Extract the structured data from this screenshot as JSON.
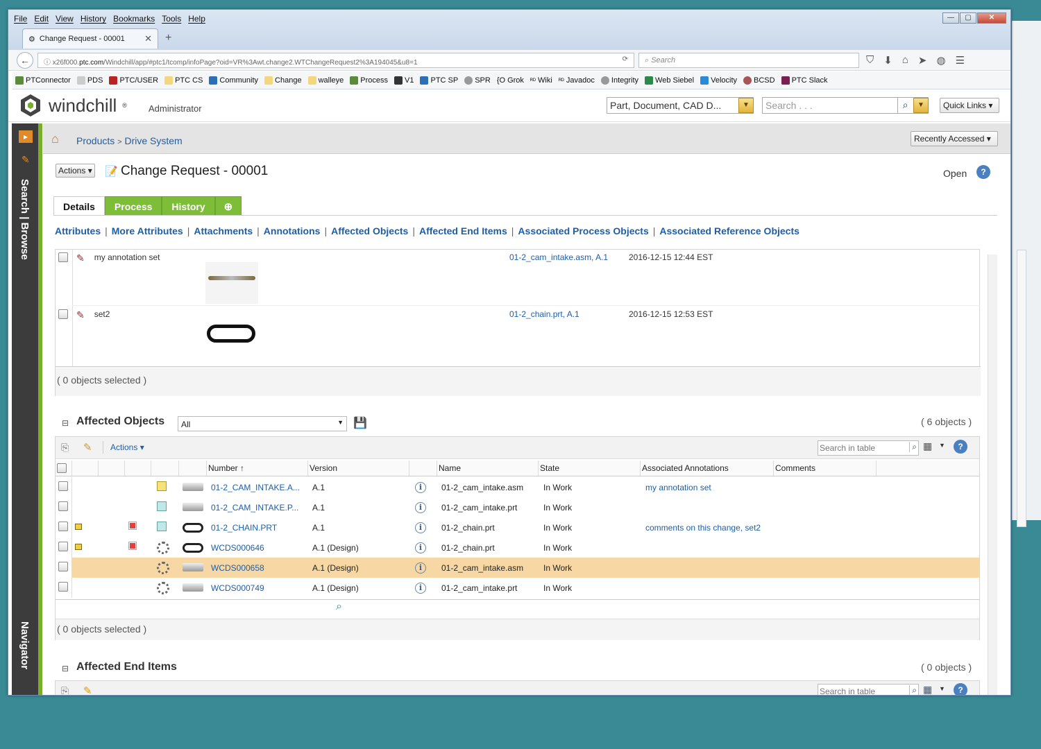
{
  "browser": {
    "menu": [
      "File",
      "Edit",
      "View",
      "History",
      "Bookmarks",
      "Tools",
      "Help"
    ],
    "tab_title": "Change Request - 00001",
    "url_prefix": "x26f000.",
    "url_host": "ptc.com",
    "url_rest": "/Windchill/app/#ptc1/tcomp/infoPage?oid=VR%3Awt.change2.WTChangeRequest2%3A194045&u8=1",
    "search_placeholder": "Search",
    "bookmarks": [
      "PTConnector",
      "PDS",
      "PTC/USER",
      "PTC CS",
      "Community",
      "Change",
      "walleye",
      "Process",
      "V1",
      "PTC SP",
      "SPR",
      "Grok",
      "Wiki",
      "Javadoc",
      "Integrity",
      "Web Siebel",
      "Velocity",
      "BCSD",
      "PTC Slack"
    ]
  },
  "header": {
    "brand": "windchill",
    "user": "Administrator",
    "type_select": "Part, Document, CAD D...",
    "search_placeholder": "Search . . .",
    "quick_links": "Quick Links"
  },
  "leftnav": {
    "search_browse": "Search | Browse",
    "navigator": "Navigator"
  },
  "breadcrumb": {
    "items": [
      "Products",
      "Drive System"
    ],
    "sep": ">",
    "recently_accessed": "Recently Accessed"
  },
  "page": {
    "actions": "Actions",
    "title": "Change Request - 00001",
    "state": "Open",
    "tabs": [
      "Details",
      "Process",
      "History"
    ],
    "sublinks": [
      "Attributes",
      "More Attributes",
      "Attachments",
      "Annotations",
      "Affected Objects",
      "Affected End Items",
      "Associated Process Objects",
      "Associated Reference Objects"
    ]
  },
  "annotations": {
    "rows": [
      {
        "name": "my annotation set",
        "object": "01-2_cam_intake.asm, A.1",
        "date": "2016-12-15 12:44 EST"
      },
      {
        "name": "set2",
        "object": "01-2_chain.prt, A.1",
        "date": "2016-12-15 12:53 EST"
      }
    ],
    "selected": "( 0 objects selected )"
  },
  "affected_objects": {
    "title": "Affected Objects",
    "filter": "All",
    "count": "( 6 objects )",
    "actions": "Actions",
    "search_placeholder": "Search in table",
    "columns": [
      "Number",
      "Version",
      "Name",
      "State",
      "Associated Annotations",
      "Comments"
    ],
    "rows": [
      {
        "number": "01-2_CAM_INTAKE.A...",
        "version": "A.1",
        "name": "01-2_cam_intake.asm",
        "state": "In Work",
        "annotations": "my annotation set",
        "highlight": false
      },
      {
        "number": "01-2_CAM_INTAKE.P...",
        "version": "A.1",
        "name": "01-2_cam_intake.prt",
        "state": "In Work",
        "annotations": "",
        "highlight": false
      },
      {
        "number": "01-2_CHAIN.PRT",
        "version": "A.1",
        "name": "01-2_chain.prt",
        "state": "In Work",
        "annotations": "comments on this change, set2",
        "highlight": false
      },
      {
        "number": "WCDS000646",
        "version": "A.1 (Design)",
        "name": "01-2_chain.prt",
        "state": "In Work",
        "annotations": "",
        "highlight": false
      },
      {
        "number": "WCDS000658",
        "version": "A.1 (Design)",
        "name": "01-2_cam_intake.asm",
        "state": "In Work",
        "annotations": "",
        "highlight": true
      },
      {
        "number": "WCDS000749",
        "version": "A.1 (Design)",
        "name": "01-2_cam_intake.prt",
        "state": "In Work",
        "annotations": "",
        "highlight": false
      }
    ],
    "selected": "( 0 objects selected )"
  },
  "affected_end_items": {
    "title": "Affected End Items",
    "count": "( 0 objects )",
    "search_placeholder": "Search in table"
  }
}
